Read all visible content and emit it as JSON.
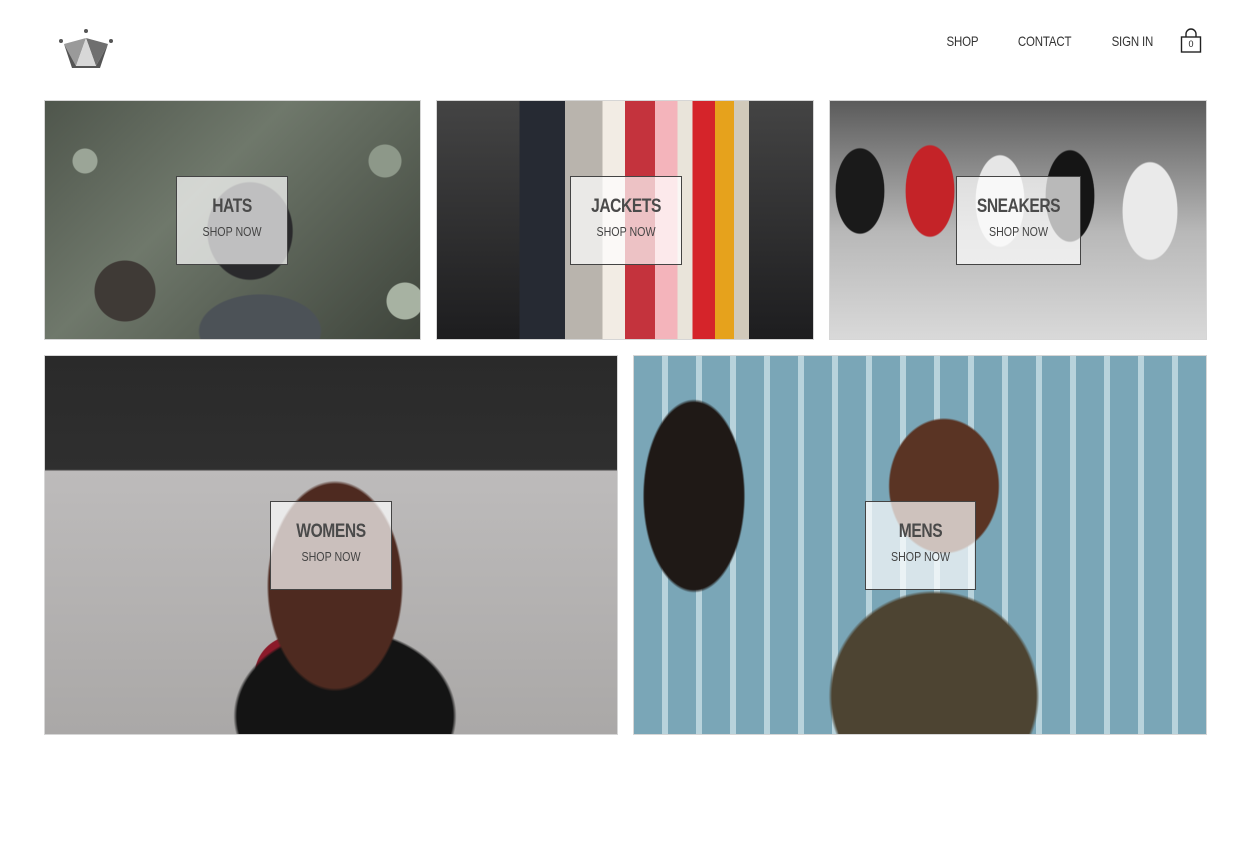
{
  "header": {
    "logo": "crown-logo",
    "nav": [
      {
        "label": "SHOP"
      },
      {
        "label": "CONTACT"
      },
      {
        "label": "SIGN IN"
      }
    ],
    "cart": {
      "icon": "shopping-bag-icon",
      "count": "0"
    }
  },
  "categories": [
    {
      "title": "HATS",
      "cta": "SHOP NOW"
    },
    {
      "title": "JACKETS",
      "cta": "SHOP NOW"
    },
    {
      "title": "SNEAKERS",
      "cta": "SHOP NOW"
    },
    {
      "title": "WOMENS",
      "cta": "SHOP NOW"
    },
    {
      "title": "MENS",
      "cta": "SHOP NOW"
    }
  ]
}
